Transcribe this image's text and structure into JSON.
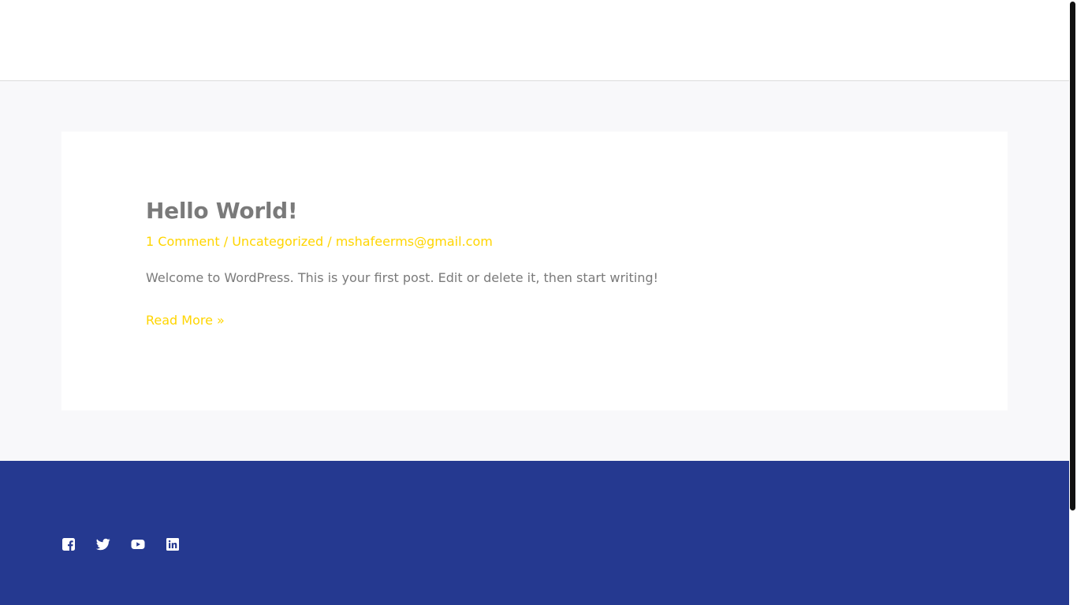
{
  "post": {
    "title": "Hello World!",
    "comments_link": "1 Comment",
    "category_link": "Uncategorized",
    "author_link": "mshafeerms@gmail.com",
    "meta_separator": " / ",
    "excerpt": "Welcome to WordPress. This is your first post. Edit or delete it, then start writing!",
    "read_more": "Read More »"
  },
  "footer": {
    "social": [
      {
        "name": "facebook-icon"
      },
      {
        "name": "twitter-icon"
      },
      {
        "name": "youtube-icon"
      },
      {
        "name": "linkedin-icon"
      }
    ]
  },
  "colors": {
    "accent": "#ffd500",
    "heading": "#7a7a7a",
    "body_text": "#7a7a7a",
    "footer_bg": "#253990",
    "page_bg": "#f8f8fa"
  }
}
